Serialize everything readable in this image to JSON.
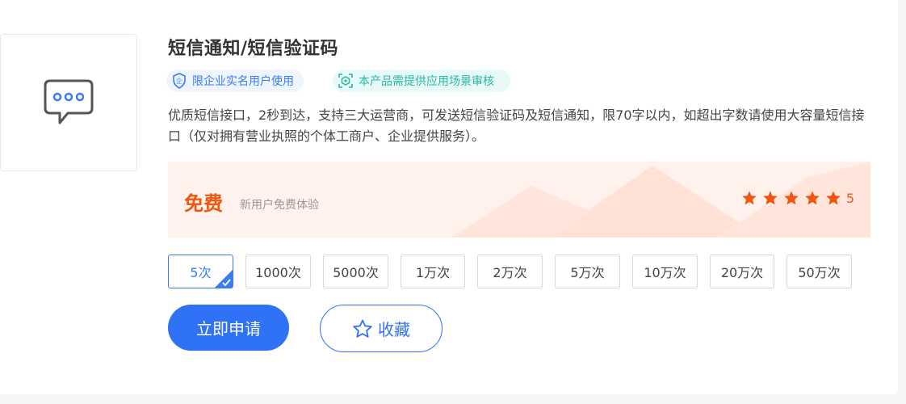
{
  "product": {
    "title": "短信通知/短信验证码",
    "tags": [
      {
        "label": "限企业实名用户使用",
        "icon": "enterprise-shield-icon",
        "color": "#3a7cf6"
      },
      {
        "label": "本产品需提供应用场景审核",
        "icon": "scan-review-icon",
        "color": "#28b8a6"
      }
    ],
    "description": "优质短信接口，2秒到达，支持三大运营商，可发送短信验证码及短信通知，限70字以内，如超出字数请使用大容量短信接口（仅对拥有营业执照的个体工商户、企业提供服务）。",
    "thumbnail_icon": "chat-bubble-icon"
  },
  "pricing": {
    "price": "免费",
    "note": "新用户免费体验",
    "rating": "5",
    "stars": 5,
    "accent": "#f0560f"
  },
  "options": [
    {
      "label": "5次",
      "selected": true
    },
    {
      "label": "1000次",
      "selected": false
    },
    {
      "label": "5000次",
      "selected": false
    },
    {
      "label": "1万次",
      "selected": false
    },
    {
      "label": "2万次",
      "selected": false
    },
    {
      "label": "5万次",
      "selected": false
    },
    {
      "label": "10万次",
      "selected": false
    },
    {
      "label": "20万次",
      "selected": false
    },
    {
      "label": "50万次",
      "selected": false
    }
  ],
  "actions": {
    "apply_label": "立即申请",
    "favorite_label": "收藏",
    "favorite_icon": "star-outline-icon",
    "primary_color": "#2f72f6"
  }
}
